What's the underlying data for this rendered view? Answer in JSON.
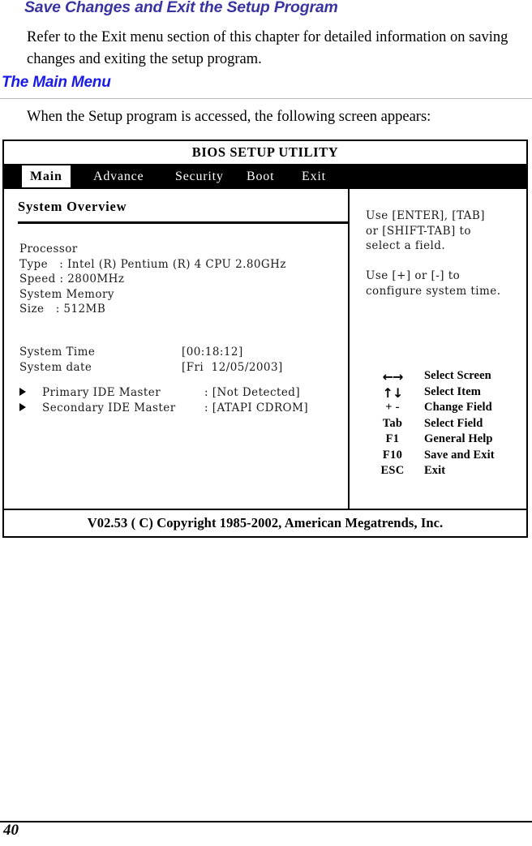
{
  "document": {
    "heading_1": "Save Changes and Exit the Setup Program",
    "paragraph_1": "Refer to the Exit menu section of this chapter for detailed information on saving changes and exiting the setup program.",
    "heading_2": "The Main Menu",
    "paragraph_2": "When the Setup program is accessed, the following screen appears:",
    "page_number": "40"
  },
  "colors": {
    "heading_1_color": "#3a34a0",
    "heading_2_color": "#1a1ae8",
    "bios_tabbar_bg": "#000000",
    "bios_active_tab_bg": "#ffffff",
    "text": "#000000"
  },
  "bios": {
    "title": "BIOS SETUP UTILITY",
    "tabs": [
      {
        "label": "Main",
        "active": true
      },
      {
        "label": "Advance",
        "active": false
      },
      {
        "label": "Security",
        "active": false
      },
      {
        "label": "Boot",
        "active": false
      },
      {
        "label": "Exit",
        "active": false
      }
    ],
    "left_panel": {
      "section_title": "System Overview",
      "processor": {
        "group_label": "Processor",
        "rows": [
          {
            "label": "Type",
            "sep": ":",
            "value": "Intel (R) Pentium (R) 4 CPU 2.80GHz"
          },
          {
            "label": "Speed",
            "sep": ":",
            "value": "2800MHz"
          }
        ]
      },
      "memory": {
        "group_label": "System Memory",
        "rows": [
          {
            "label": "Size",
            "sep": ":",
            "value": "512MB"
          }
        ]
      },
      "processor_block_text": "Processor\nType   : Intel (R) Pentium (R) 4 CPU 2.80GHz\nSpeed : 2800MHz\nSystem Memory\nSize   : 512MB",
      "time_rows": [
        {
          "label": "System Time",
          "value": "[00:18:12]"
        },
        {
          "label": "System date",
          "value": "[Fri  12/05/2003]"
        }
      ],
      "ide_rows": [
        {
          "label": "Primary IDE Master",
          "value": ": [Not Detected]"
        },
        {
          "label": "Secondary IDE Master",
          "value": ": [ATAPI CDROM]"
        }
      ]
    },
    "right_panel": {
      "help_text": "Use [ENTER], [TAB]\nor [SHIFT-TAB] to\nselect a field.\n\nUse [+] or [-] to\nconfigure system time.",
      "key_legend": [
        {
          "key": "←→",
          "symbol": true,
          "desc": "Select Screen"
        },
        {
          "key": "↑↓",
          "symbol": true,
          "desc": "Select Item"
        },
        {
          "key": "+ -",
          "symbol": false,
          "desc": "Change Field"
        },
        {
          "key": "Tab",
          "symbol": false,
          "desc": "Select Field"
        },
        {
          "key": "F1",
          "symbol": false,
          "desc": "General Help"
        },
        {
          "key": "F10",
          "symbol": false,
          "desc": "Save and Exit"
        },
        {
          "key": "ESC",
          "symbol": false,
          "desc": "Exit"
        }
      ]
    },
    "footer": "V02.53 ( C) Copyright 1985-2002, American Megatrends, Inc."
  }
}
